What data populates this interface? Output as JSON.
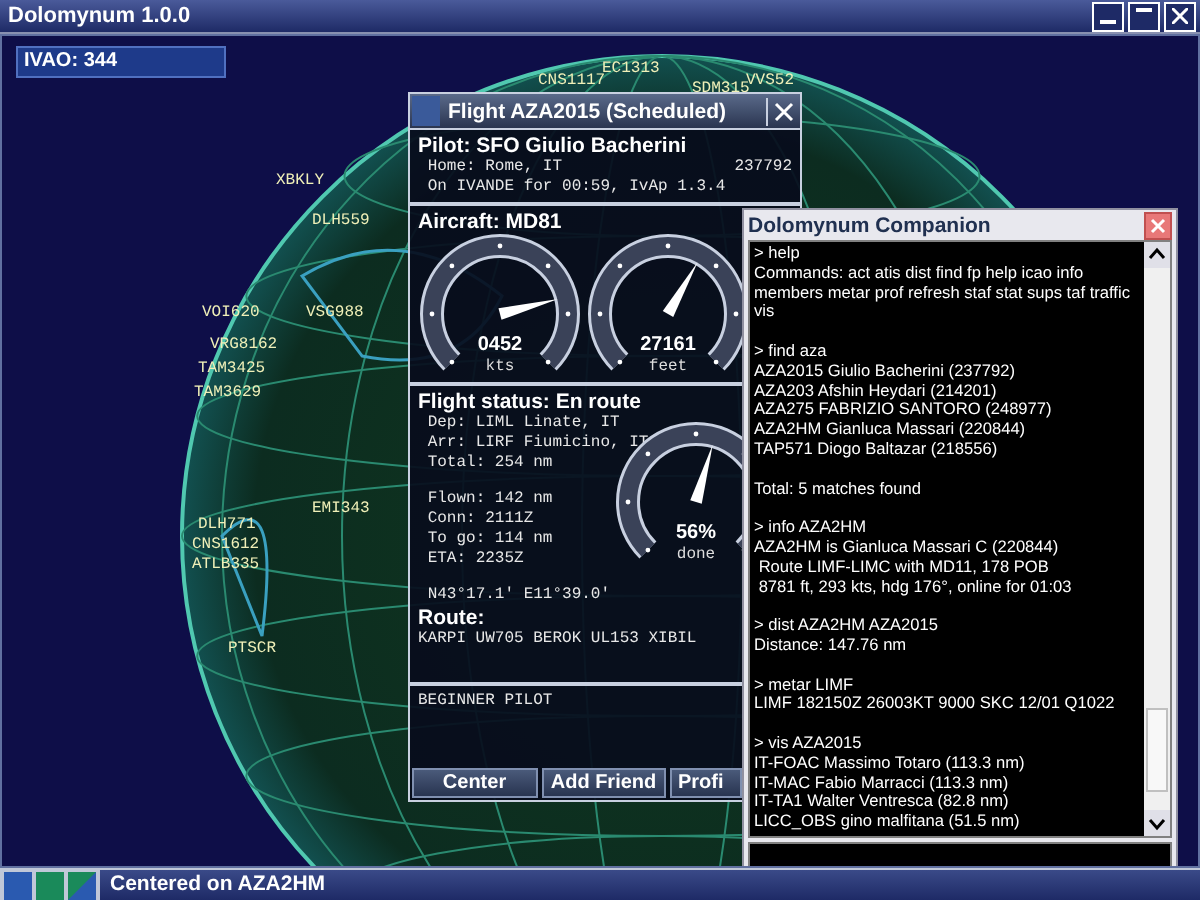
{
  "window": {
    "title": "Dolomynum 1.0.0"
  },
  "network_count": "IVAO: 344",
  "map_labels": [
    "CNS1117",
    "EC1313",
    "SDM315",
    "VVS52",
    "XBKLY",
    "DLH559",
    "VOI620",
    "VSG988",
    "VRG8162",
    "TAM3425",
    "TAM3629",
    "EMI343",
    "DLH771",
    "CNS1612",
    "ATLB335",
    "PTSCR"
  ],
  "flight_panel": {
    "title": "Flight AZA2015 (Scheduled)",
    "pilot": {
      "heading": "Pilot: SFO Giulio Bacherini",
      "home": "Home: Rome, IT",
      "id": "237792",
      "online": "On IVANDE for 00:59, IvAp 1.3.4"
    },
    "aircraft": {
      "heading": "Aircraft: MD81",
      "gauges": [
        {
          "value": "0452",
          "unit": "kts",
          "level": 0.78
        },
        {
          "value": "27161",
          "unit": "feet",
          "level": 0.61
        }
      ]
    },
    "status": {
      "heading": "Flight status: En route",
      "lines": [
        "Dep: LIML Linate, IT",
        "Arr: LIRF Fiumicino, IT",
        "Total: 254 nm"
      ],
      "progress": [
        "Flown: 142 nm",
        "Conn: 2111Z",
        "To go: 114 nm",
        "ETA: 2235Z"
      ],
      "position": "N43°17.1' E11°39.0'",
      "gauge": {
        "value": "56%",
        "unit": "done",
        "level": 0.56
      }
    },
    "route": {
      "heading": "Route:",
      "text": "KARPI UW705 BEROK UL153 XIBIL"
    },
    "remarks": "BEGINNER PILOT",
    "buttons": [
      "Center",
      "Add Friend",
      "Profi"
    ]
  },
  "companion": {
    "title": "Dolomynum Companion",
    "console": [
      {
        "command": "> help",
        "output": [
          "Commands: act atis dist find fp help icao info members metar prof refresh staf stat sups taf traffic vis"
        ]
      },
      {
        "command": "> find aza",
        "output": [
          "AZA2015 Giulio Bacherini (237792)",
          "AZA203 Afshin Heydari (214201)",
          "AZA275 FABRIZIO SANTORO (248977)",
          "AZA2HM Gianluca Massari (220844)",
          "TAP571 Diogo Baltazar (218556)"
        ],
        "summary": "Total: 5 matches found"
      },
      {
        "command": "> info AZA2HM",
        "output": [
          "AZA2HM is Gianluca Massari C (220844)",
          " Route LIMF-LIMC with MD11, 178 POB",
          " 8781 ft, 293 kts, hdg 176°, online for 01:03"
        ]
      },
      {
        "command": "> dist AZA2HM AZA2015",
        "output": [
          "Distance: 147.76 nm"
        ]
      },
      {
        "command": "> metar LIMF",
        "output": [
          "LIMF 182150Z 26003KT 9000 SKC 12/01 Q1022"
        ]
      },
      {
        "command": "> vis AZA2015",
        "output": [
          "IT-FOAC Massimo Totaro (113.3 nm)",
          "IT-MAC Fabio Marracci (113.3 nm)",
          "IT-TA1 Walter Ventresca (82.8 nm)",
          "LICC_OBS gino malfitana (51.5 nm)"
        ]
      }
    ]
  },
  "status_bar": {
    "text": "Centered on AZA2HM"
  }
}
